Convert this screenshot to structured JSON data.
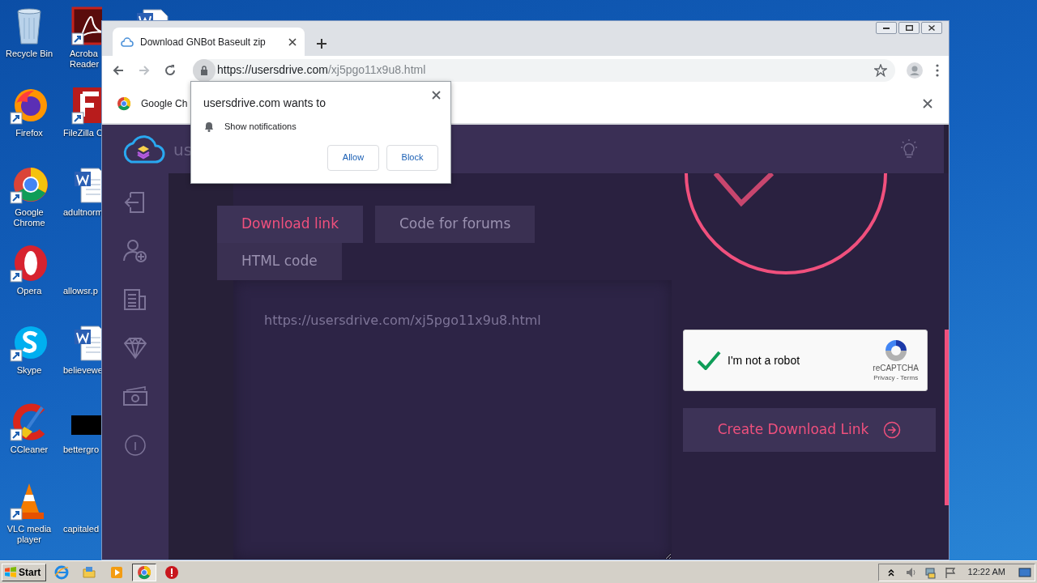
{
  "desktop_icons": [
    {
      "label": "Recycle Bin"
    },
    {
      "label": "Firefox"
    },
    {
      "label": "Google Chrome"
    },
    {
      "label": "Opera"
    },
    {
      "label": "Skype"
    },
    {
      "label": "CCleaner"
    },
    {
      "label": "VLC media player"
    }
  ],
  "desktop_icons_cut": [
    {
      "label": "Acroba Reader"
    },
    {
      "label": "FileZilla C"
    },
    {
      "label": "adultnorm"
    },
    {
      "label": "allowsr.p"
    },
    {
      "label": "believewe"
    },
    {
      "label": "bettergro"
    },
    {
      "label": "capitaled"
    }
  ],
  "browser": {
    "tab_title": "Download GNBot Baseult zip",
    "url_host": "https://usersdrive.com",
    "url_path": "/xj5pgo11x9u8.html",
    "infobar_text": "Google Ch"
  },
  "permission_popup": {
    "title": "usersdrive.com wants to",
    "permission": "Show notifications",
    "buttons": [
      "Allow",
      "Block"
    ]
  },
  "site": {
    "brand": "us",
    "tabs": [
      {
        "label": "Download link",
        "selected": true
      },
      {
        "label": "Code for forums",
        "selected": false
      },
      {
        "label": "HTML code",
        "selected": false
      }
    ],
    "link_text": "https://usersdrive.com/xj5pgo11x9u8.html",
    "captcha": {
      "checked": true,
      "label": "I'm not a robot",
      "brand": "reCAPTCHA",
      "links": "Privacy - Terms"
    },
    "create_button": "Create Download Link"
  },
  "taskbar": {
    "start": "Start",
    "apps": [
      {
        "selected": false
      },
      {
        "selected": false
      },
      {
        "selected": false
      },
      {
        "selected": true
      },
      {
        "selected": false
      }
    ],
    "clock": "12:22 AM"
  }
}
